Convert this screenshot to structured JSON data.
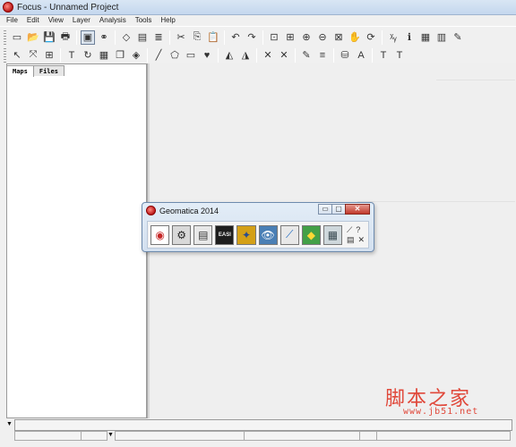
{
  "window": {
    "title": "Focus - Unnamed Project"
  },
  "menu": [
    "File",
    "Edit",
    "View",
    "Layer",
    "Analysis",
    "Tools",
    "Help"
  ],
  "toolbar1": {
    "items": [
      {
        "name": "new-icon",
        "glyph": "▭"
      },
      {
        "name": "open-icon",
        "glyph": "📂"
      },
      {
        "name": "save-icon",
        "glyph": "💾"
      },
      {
        "name": "print-icon",
        "glyph": "🖶"
      },
      {
        "name": "sep"
      },
      {
        "name": "view-select-icon",
        "glyph": "▣"
      },
      {
        "name": "link-icon",
        "glyph": "⚭"
      },
      {
        "name": "sep"
      },
      {
        "name": "eraser-icon",
        "glyph": "◇"
      },
      {
        "name": "window-icon",
        "glyph": "▤"
      },
      {
        "name": "layers-icon",
        "glyph": "≣"
      },
      {
        "name": "sep"
      },
      {
        "name": "cut-icon",
        "glyph": "✂"
      },
      {
        "name": "copy-icon",
        "glyph": "⎘"
      },
      {
        "name": "paste-icon",
        "glyph": "📋"
      },
      {
        "name": "sep"
      },
      {
        "name": "undo-icon",
        "glyph": "↶"
      },
      {
        "name": "redo-icon",
        "glyph": "↷"
      },
      {
        "name": "sep"
      },
      {
        "name": "zoom-extent-icon",
        "glyph": "⊡"
      },
      {
        "name": "zoom-box-icon",
        "glyph": "⊞"
      },
      {
        "name": "zoom-in-icon",
        "glyph": "⊕"
      },
      {
        "name": "zoom-out-icon",
        "glyph": "⊖"
      },
      {
        "name": "zoom-layer-icon",
        "glyph": "⊠"
      },
      {
        "name": "pan-icon",
        "glyph": "✋"
      },
      {
        "name": "refresh-icon",
        "glyph": "⟳"
      },
      {
        "name": "sep"
      },
      {
        "name": "xy-icon",
        "glyph": "ᵡᵧ"
      },
      {
        "name": "info-icon",
        "glyph": "ℹ"
      },
      {
        "name": "table-icon",
        "glyph": "▦"
      },
      {
        "name": "chart-icon",
        "glyph": "▥"
      },
      {
        "name": "pencil-icon",
        "glyph": "✎"
      }
    ]
  },
  "toolbar2": {
    "items": [
      {
        "name": "pointer-icon",
        "glyph": "↖"
      },
      {
        "name": "node-edit-icon",
        "glyph": "⤧"
      },
      {
        "name": "grid-icon",
        "glyph": "⊞"
      },
      {
        "name": "sep"
      },
      {
        "name": "text-icon",
        "glyph": "T"
      },
      {
        "name": "rotate-icon",
        "glyph": "↻"
      },
      {
        "name": "raster-grid-icon",
        "glyph": "▦"
      },
      {
        "name": "clone-icon",
        "glyph": "❐"
      },
      {
        "name": "fill-icon",
        "glyph": "◈"
      },
      {
        "name": "sep"
      },
      {
        "name": "line-icon",
        "glyph": "╱"
      },
      {
        "name": "polygon-icon",
        "glyph": "⬠"
      },
      {
        "name": "note-icon",
        "glyph": "▭"
      },
      {
        "name": "heart-icon",
        "glyph": "♥"
      },
      {
        "name": "sep"
      },
      {
        "name": "layer-up-icon",
        "glyph": "◭"
      },
      {
        "name": "layer-down-icon",
        "glyph": "◮"
      },
      {
        "name": "sep"
      },
      {
        "name": "vertex-add-icon",
        "glyph": "✕"
      },
      {
        "name": "vertex-del-icon",
        "glyph": "✕"
      },
      {
        "name": "sep"
      },
      {
        "name": "line-color-icon",
        "glyph": "✎"
      },
      {
        "name": "line-style-icon",
        "glyph": "≡"
      },
      {
        "name": "sep"
      },
      {
        "name": "fill-color-icon",
        "glyph": "⛁"
      },
      {
        "name": "font-color-icon",
        "glyph": "A"
      },
      {
        "name": "sep"
      },
      {
        "name": "font-icon",
        "glyph": "T"
      },
      {
        "name": "font-size-icon",
        "glyph": "T"
      }
    ]
  },
  "left_tabs": [
    "Maps",
    "Files"
  ],
  "dialog": {
    "title": "Geomatica 2014",
    "controls": [
      "▭",
      "▢",
      "✕"
    ],
    "tools": [
      {
        "name": "focus-tool-icon",
        "glyph": "◉",
        "bg": "#ffffff",
        "fg": "#c62828"
      },
      {
        "name": "modeler-tool-icon",
        "glyph": "⚙",
        "bg": "#d9d9d9",
        "fg": "#222"
      },
      {
        "name": "easi-window-icon",
        "glyph": "▤",
        "bg": "#e8e8e8",
        "fg": "#333"
      },
      {
        "name": "easi-tool-icon",
        "glyph": "EASI",
        "bg": "#1e1e1e",
        "fg": "#f0f0f0"
      },
      {
        "name": "ortho-engine-icon",
        "glyph": "✦",
        "bg": "#d4a017",
        "fg": "#2a4d8f"
      },
      {
        "name": "eye-tool-icon",
        "glyph": "👁",
        "bg": "#4a7fb5",
        "fg": "#fff"
      },
      {
        "name": "satellite-tool-icon",
        "glyph": "⟋",
        "bg": "#e8e8e8",
        "fg": "#1565c0"
      },
      {
        "name": "mosaic-tool-icon",
        "glyph": "◆",
        "bg": "#43a047",
        "fg": "#fdd835"
      },
      {
        "name": "chip-manager-icon",
        "glyph": "▦",
        "bg": "#cfd8dc",
        "fg": "#37474f"
      }
    ],
    "mini": [
      "⟋",
      "?",
      "▤",
      "✕"
    ]
  },
  "watermark": {
    "chinese": "脚本之家",
    "url": "www.jb51.net"
  }
}
